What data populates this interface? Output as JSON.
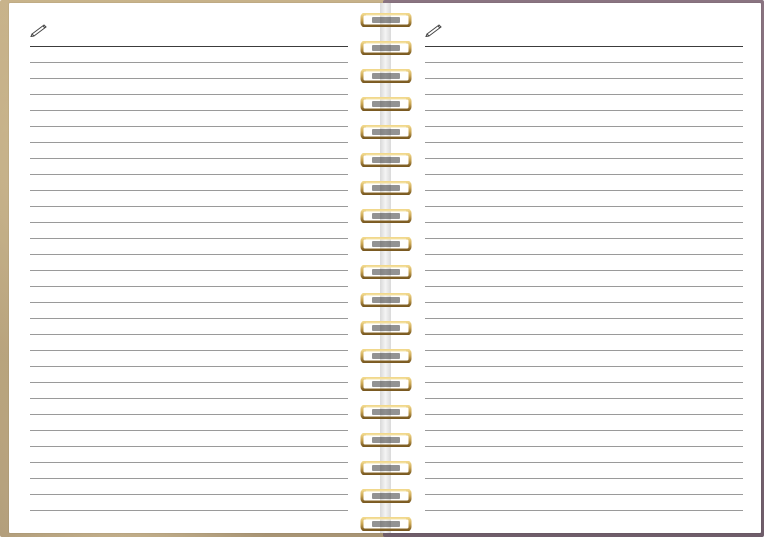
{
  "notebook": {
    "left_page": {
      "line_count": 30
    },
    "right_page": {
      "line_count": 30
    },
    "ring_count": 19,
    "icons": {
      "page_marker": "pencil-icon"
    },
    "colors": {
      "page": "#ffffff",
      "rule": "#9a9a9a",
      "first_rule": "#3c3c3c",
      "ring_gold": "#c9a451",
      "left_cover": "#c7b28a",
      "right_cover": "#7c6875"
    }
  }
}
